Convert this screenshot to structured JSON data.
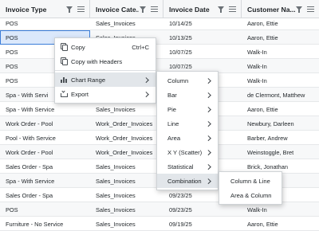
{
  "columns": [
    {
      "label": "Invoice Type"
    },
    {
      "label": "Invoice Cate..."
    },
    {
      "label": "Invoice Date"
    },
    {
      "label": "Customer Na..."
    }
  ],
  "rows": [
    {
      "type": "POS",
      "category": "Sales_Invoices",
      "date": "10/14/25",
      "customer": "Aaron, Ettie"
    },
    {
      "type": "POS",
      "category": "Sales_Invoices",
      "date": "10/13/25",
      "customer": "Aaron, Ettie"
    },
    {
      "type": "POS",
      "category": "",
      "date": "10/07/25",
      "customer": "Walk-In"
    },
    {
      "type": "POS",
      "category": "",
      "date": "10/07/25",
      "customer": "Walk-In"
    },
    {
      "type": "POS",
      "category": "",
      "date": "",
      "customer": "Walk-In"
    },
    {
      "type": "Spa - With Servi",
      "category": "",
      "date": "",
      "customer": "de Clermont, Matthew"
    },
    {
      "type": "Spa - With Service",
      "category": "Sales_Invoices",
      "date": "",
      "customer": "Aaron, Ettie"
    },
    {
      "type": "Work Order - Pool",
      "category": "Work_Order_Invoices",
      "date": "",
      "customer": "Newbury, Darleen"
    },
    {
      "type": "Pool - With Service",
      "category": "Work_Order_Invoices",
      "date": "",
      "customer": "Barber, Andrew"
    },
    {
      "type": "Work Order - Pool",
      "category": "Work_Order_Invoices",
      "date": "",
      "customer": "Weinstoggle, Bret"
    },
    {
      "type": "Sales Order - Spa",
      "category": "Sales_Invoices",
      "date": "",
      "customer": "Brick, Jonathan"
    },
    {
      "type": "Spa - With Service",
      "category": "Sales_Invoices",
      "date": "",
      "customer": "ew"
    },
    {
      "type": "Sales Order - Spa",
      "category": "Sales_Invoices",
      "date": "09/23/25",
      "customer": ""
    },
    {
      "type": "POS",
      "category": "Sales_Invoices",
      "date": "09/23/25",
      "customer": "Walk-In"
    },
    {
      "type": "Furniture - No Service",
      "category": "Sales_Invoices",
      "date": "09/19/25",
      "customer": "Aaron, Ettie"
    }
  ],
  "context_menu": {
    "copy_label": "Copy",
    "copy_shortcut": "Ctrl+C",
    "copy_headers_label": "Copy with Headers",
    "chart_range_label": "Chart Range",
    "export_label": "Export"
  },
  "chart_submenu": {
    "items": [
      "Column",
      "Bar",
      "Pie",
      "Line",
      "Area",
      "X Y (Scatter)",
      "Statistical",
      "Combination"
    ]
  },
  "combination_submenu": {
    "items": [
      "Column & Line",
      "Area & Column"
    ]
  },
  "colors": {
    "accent": "#3b7dd8",
    "header_bg": "#f6f7f8",
    "menu_hover": "#e2e6ea"
  }
}
